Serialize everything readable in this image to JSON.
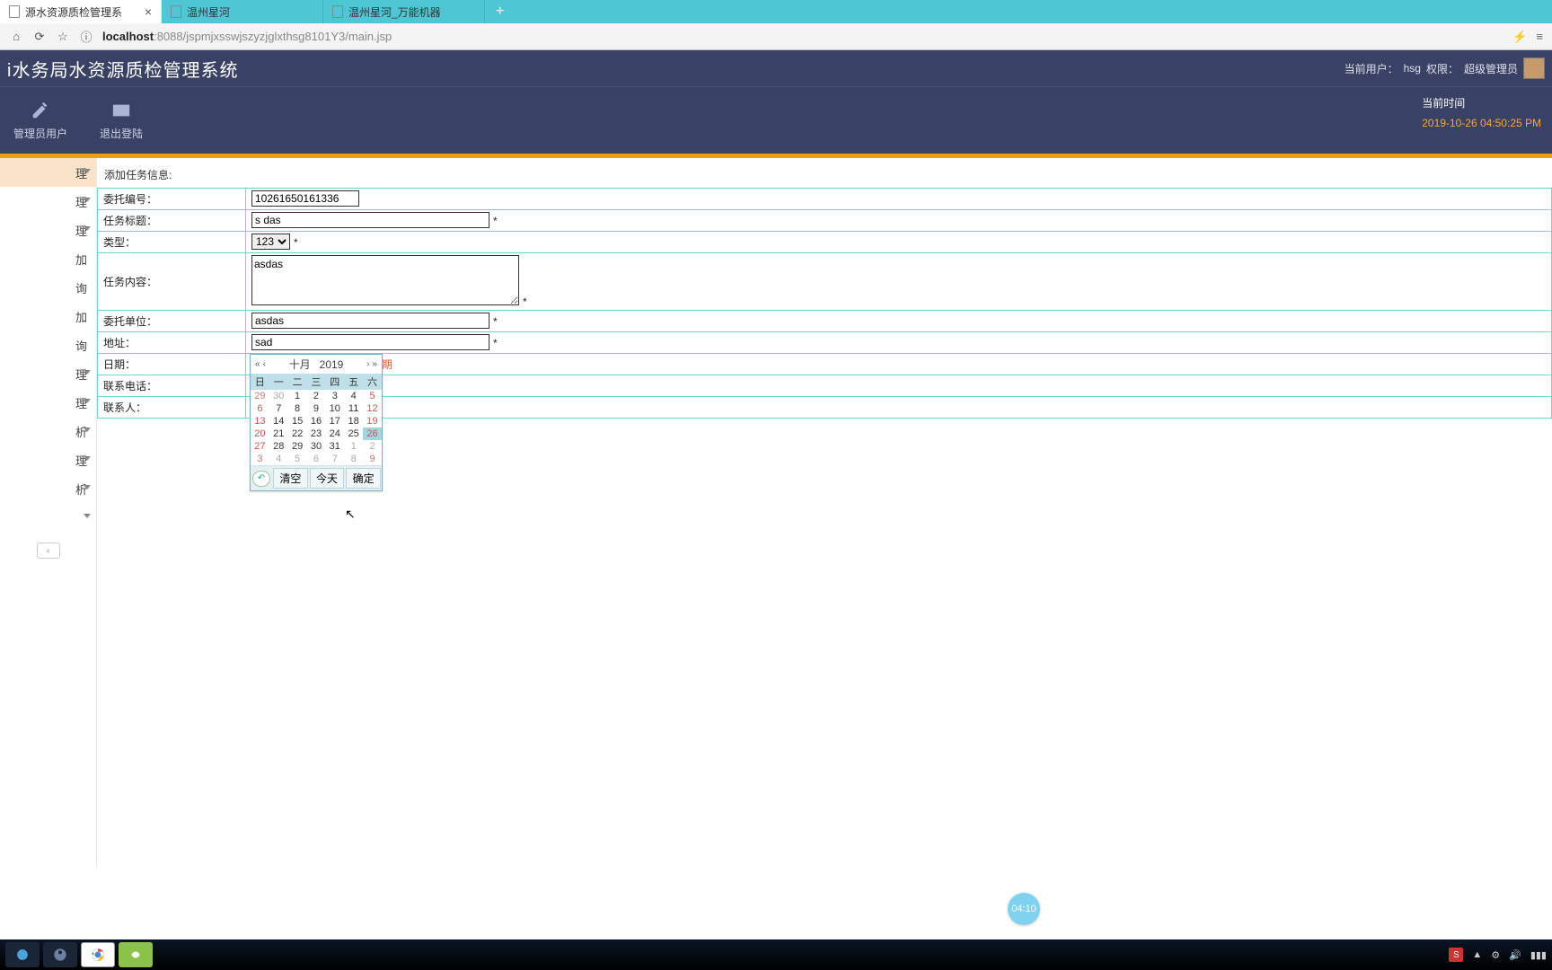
{
  "tabs": [
    {
      "label": "源水资源质检管理系",
      "active": true
    },
    {
      "label": "温州星河",
      "active": false
    },
    {
      "label": "温州星河_万能机器",
      "active": false
    }
  ],
  "url_host": "localhost",
  "url_port_path": ":8088/jspmjxsswjszyzjglxthsg8101Y3/main.jsp",
  "app_title": "i水务局水资源质检管理系统",
  "user_line_prefix": "当前用户：",
  "user_name": "hsg",
  "role_prefix": "  权限：",
  "role_name": "超级管理员",
  "tool_admin": "管理员用户",
  "tool_logout": "退出登陆",
  "time_label": "当前时间",
  "time_value": "2019-10-26 04:50:25 PM",
  "sidebar": [
    "理",
    "理",
    "理",
    "加",
    "询",
    "加",
    "询",
    "理",
    "理",
    "析",
    "理",
    "析",
    ""
  ],
  "section": "添加任务信息:",
  "form": {
    "entrust_no_label": "委托编号：",
    "entrust_no": "10261650161336",
    "title_label": "任务标题：",
    "title": "s das",
    "type_label": "类型：",
    "type": "123",
    "content_label": "任务内容：",
    "content": "asdas",
    "unit_label": "委托单位：",
    "unit": "asdas",
    "address_label": "地址：",
    "address": "sad",
    "date_label": "日期：",
    "date": "",
    "date_err": "* 请输入日期",
    "phone_label": "联系电话：",
    "contact_label": "联系人："
  },
  "dp": {
    "month": "十月",
    "year": "2019",
    "dow": [
      "日",
      "一",
      "二",
      "三",
      "四",
      "五",
      "六"
    ],
    "grid": [
      [
        {
          "d": 29,
          "c": "om"
        },
        {
          "d": 30,
          "c": "og"
        },
        {
          "d": 1
        },
        {
          "d": 2
        },
        {
          "d": 3
        },
        {
          "d": 4
        },
        {
          "d": 5,
          "c": "sat"
        }
      ],
      [
        {
          "d": 6,
          "c": "sun"
        },
        {
          "d": 7
        },
        {
          "d": 8
        },
        {
          "d": 9
        },
        {
          "d": 10
        },
        {
          "d": 11
        },
        {
          "d": 12,
          "c": "sat"
        }
      ],
      [
        {
          "d": 13,
          "c": "sun"
        },
        {
          "d": 14
        },
        {
          "d": 15
        },
        {
          "d": 16
        },
        {
          "d": 17
        },
        {
          "d": 18
        },
        {
          "d": 19,
          "c": "sat"
        }
      ],
      [
        {
          "d": 20,
          "c": "sun"
        },
        {
          "d": 21
        },
        {
          "d": 22
        },
        {
          "d": 23
        },
        {
          "d": 24
        },
        {
          "d": 25
        },
        {
          "d": 26,
          "c": "sat today"
        }
      ],
      [
        {
          "d": 27,
          "c": "sun"
        },
        {
          "d": 28
        },
        {
          "d": 29
        },
        {
          "d": 30
        },
        {
          "d": 31
        },
        {
          "d": 1,
          "c": "og"
        },
        {
          "d": 2,
          "c": "og"
        }
      ],
      [
        {
          "d": 3,
          "c": "om"
        },
        {
          "d": 4,
          "c": "og"
        },
        {
          "d": 5,
          "c": "og"
        },
        {
          "d": 6,
          "c": "og"
        },
        {
          "d": 7,
          "c": "og"
        },
        {
          "d": 8,
          "c": "og"
        },
        {
          "d": 9,
          "c": "om"
        }
      ]
    ],
    "clear": "清空",
    "today": "今天",
    "ok": "确定"
  },
  "badge": "04:10"
}
